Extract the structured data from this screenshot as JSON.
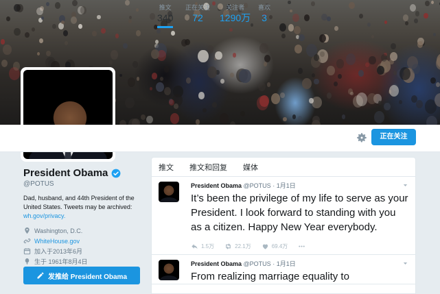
{
  "nav": {
    "stats": [
      {
        "label": "推文",
        "value": "340"
      },
      {
        "label": "正在关注",
        "value": "72"
      },
      {
        "label": "关注者",
        "value": "1290万"
      },
      {
        "label": "喜欢",
        "value": "3"
      }
    ],
    "follow_button": "正在关注"
  },
  "profile": {
    "name": "President Obama",
    "handle": "@POTUS",
    "bio": "Dad, husband, and 44th President of the United States. Tweets may be archived:",
    "bio_link": "wh.gov/privacy.",
    "location": "Washington, D.C.",
    "website": "WhiteHouse.gov",
    "joined": "加入于2013年6月",
    "born": "生于 1961年8月4日",
    "tweet_to_button": "发推给 President Obama"
  },
  "timeline": {
    "tabs": [
      "推文",
      "推文和回复",
      "媒体"
    ],
    "tweets": [
      {
        "name": "President Obama",
        "handle": "@POTUS",
        "date": "· 1月1日",
        "text": "It’s been the privilege of my life to serve as your President. I look forward to standing with you as a citizen. Happy New Year everybody.",
        "replies": "1.5万",
        "retweets": "22.1万",
        "likes": "69.4万"
      },
      {
        "name": "President Obama",
        "handle": "@POTUS",
        "date": "· 1月1日",
        "text": "From realizing marriage equality to"
      }
    ]
  },
  "colors": {
    "accent": "#1b95e0",
    "verified": "#1da1f2"
  }
}
